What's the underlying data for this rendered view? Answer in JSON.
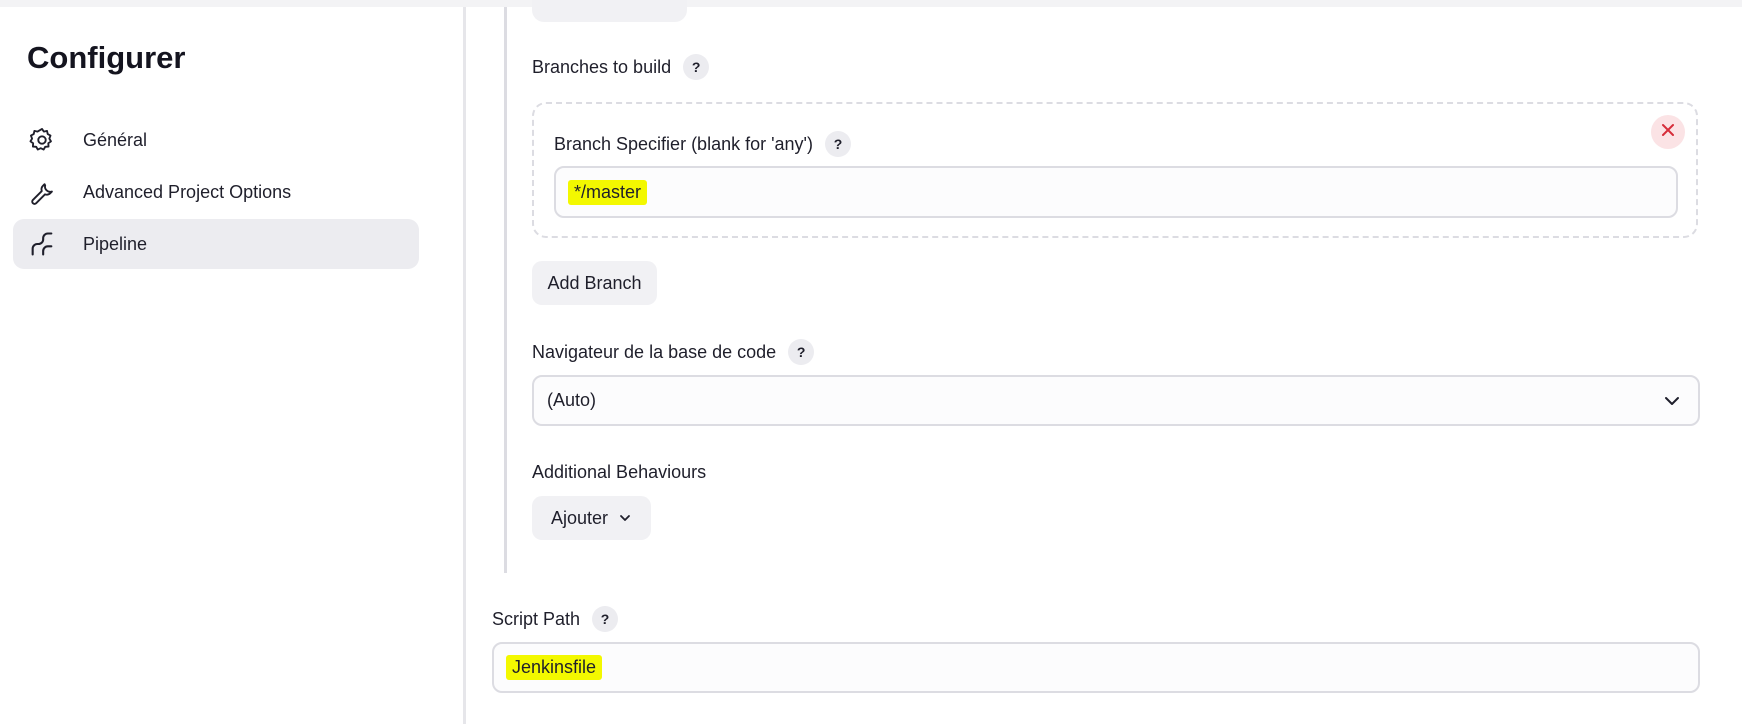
{
  "sidebar": {
    "title": "Configurer",
    "items": [
      {
        "label": "Général",
        "icon": "gear-icon"
      },
      {
        "label": "Advanced Project Options",
        "icon": "wrench-icon"
      },
      {
        "label": "Pipeline",
        "icon": "pipeline-icon",
        "active": true
      }
    ]
  },
  "scm": {
    "branches_label": "Branches to build",
    "branch_specifier_label": "Branch Specifier (blank for 'any')",
    "branch_specifier_value": "*/master",
    "add_branch_label": "Add Branch",
    "browser_label": "Navigateur de la base de code",
    "browser_selected": "(Auto)",
    "additional_behaviours_label": "Additional Behaviours",
    "add_label": "Ajouter"
  },
  "script_path": {
    "label": "Script Path",
    "value": "Jenkinsfile"
  },
  "help_symbol": "?",
  "colors": {
    "highlight": "#f3f800",
    "active_nav_bg": "#ececf0",
    "close_bg": "#fbe3e5",
    "close_icon": "#d62d3a"
  }
}
